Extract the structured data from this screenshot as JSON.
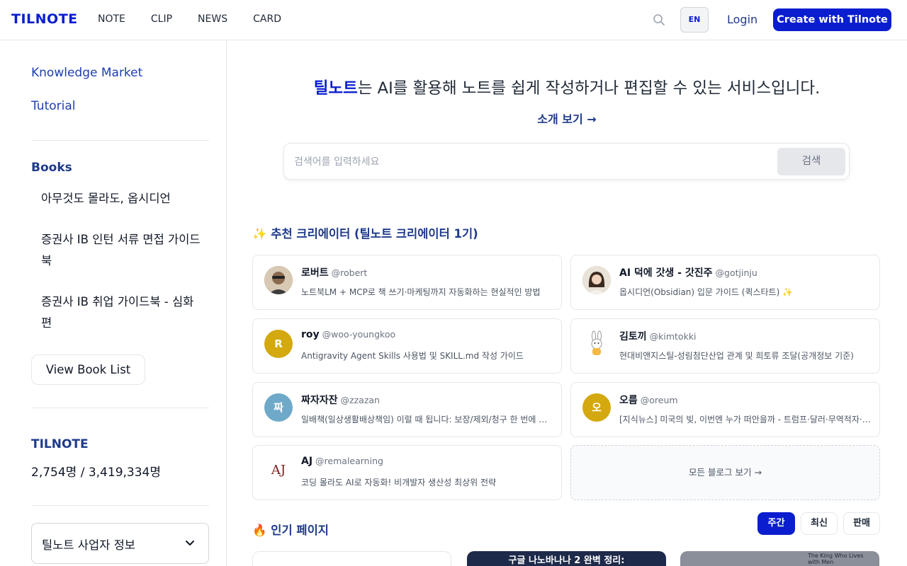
{
  "header": {
    "logo": "TILNOTE",
    "nav": [
      "NOTE",
      "CLIP",
      "NEWS",
      "CARD"
    ],
    "lang": "EN",
    "login": "Login",
    "create": "Create with Tilnote"
  },
  "sidebar": {
    "links": [
      "Knowledge Market",
      "Tutorial"
    ],
    "books_heading": "Books",
    "books": [
      "아무것도 몰라도, 옵시디언",
      "증권사 IB 인턴 서류 면접 가이드북",
      "증권사 IB 취업 가이드북 - 심화편"
    ],
    "view_books": "View Book List",
    "stats_heading": "TILNOTE",
    "stats": "2,754명 / 3,419,334명",
    "business_info": "틸노트 사업자 정보"
  },
  "main": {
    "hero_brand": "틸노트",
    "hero_rest": "는 AI를 활용해 노트를 쉽게 작성하거나 편집할 수 있는 서비스입니다.",
    "intro_link": "소개 보기 →",
    "search_placeholder": "검색어를 입력하세요",
    "search_button": "검색",
    "creators_title": "✨ 추천 크리에이터 (틸노트 크리에이터 1기)",
    "creators": [
      {
        "name": "로버트",
        "handle": "@robert",
        "desc": "노트북LM + MCP로 책 쓰기·마케팅까지 자동화하는 현실적인 방법",
        "avatar": "",
        "color": "#6b4f3a"
      },
      {
        "name": "AI 덕에 갓생 - 갓진주",
        "handle": "@gotjinju",
        "desc": "옵시디언(Obsidian) 입문 가이드 (퀵스타트) ✨",
        "avatar": "",
        "color": "#c9a98a"
      },
      {
        "name": "roy",
        "handle": "@woo-youngkoo",
        "desc": "Antigravity Agent Skills 사용법 및 SKILL.md 작성 가이드",
        "avatar": "R",
        "color": "#d4a80f"
      },
      {
        "name": "김토끼",
        "handle": "@kimtokki",
        "desc": "현대비앤지스틸-성림첨단산업 관계 및 희토류 조달(공개정보 기준)",
        "avatar": "",
        "color": "#ffffff"
      },
      {
        "name": "짜자자잔",
        "handle": "@zzazan",
        "desc": "일배책(일상생활배상책임) 이럴 때 됩니다: 보장/제외/청구 한 번에 정리",
        "avatar": "짜",
        "color": "#6fa9c9"
      },
      {
        "name": "오름",
        "handle": "@oreum",
        "desc": "[지식뉴스] 미국의 빚, 이번엔 누가 떠안을까 - 트럼프·달러·무역적자·스테이블코인",
        "avatar": "오",
        "color": "#d4a80f"
      },
      {
        "name": "AJ",
        "handle": "@remalearning",
        "desc": "코딩 몰라도 AI로 자동화! 비개발자 생산성 최상위 전략",
        "avatar": "AJ",
        "color": "#ffffff"
      }
    ],
    "all_blogs": "모든 블로그 보기 →",
    "popular_title": "🔥 인기 페이지",
    "filters": [
      "주간",
      "최신",
      "판매"
    ],
    "popular_cards": [
      "",
      "구글 나노바나나 2 완벽 정리:",
      "The King Who Lives with Men"
    ]
  }
}
